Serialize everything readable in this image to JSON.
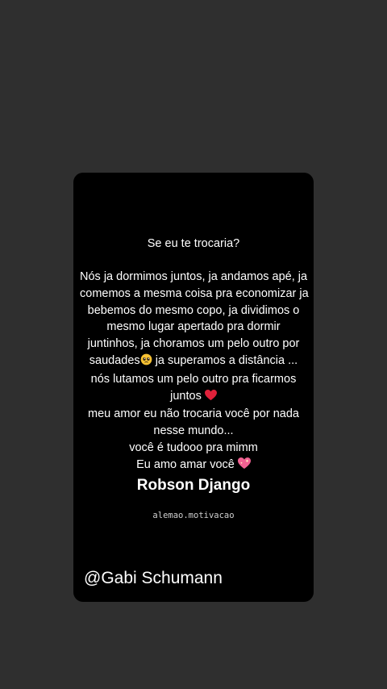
{
  "post": {
    "question": "Se eu te trocaria?",
    "lines": [
      "Nós ja dormimos juntos, ja andamos apé, ja",
      "comemos a mesma coisa pra economizar ja",
      "bebemos do mesmo copo, ja dividimos o",
      "mesmo lugar apertado pra dormir",
      "juntinhos, ja choramos um pelo outro por",
      "saudades",
      " ja superamos a distância ...",
      "nós lutamos um pelo outro pra ficarmos",
      "juntos ",
      "meu amor eu não trocaria você por nada",
      "nesse mundo...",
      "você é tudooo pra mimm",
      "Eu amo amar você "
    ],
    "author": "Robson Django",
    "handle": "alemao.motivacao",
    "watermark": "@Gabi Schumann"
  },
  "icons": [
    "pleading-face-icon",
    "red-heart-icon",
    "sparkling-heart-icon"
  ],
  "colors": {
    "background": "#2f2f2f",
    "card": "#000000",
    "text": "#ffffff",
    "heart": "#e0213a",
    "pink_heart": "#f06292",
    "emoji_face": "#f7c233"
  }
}
